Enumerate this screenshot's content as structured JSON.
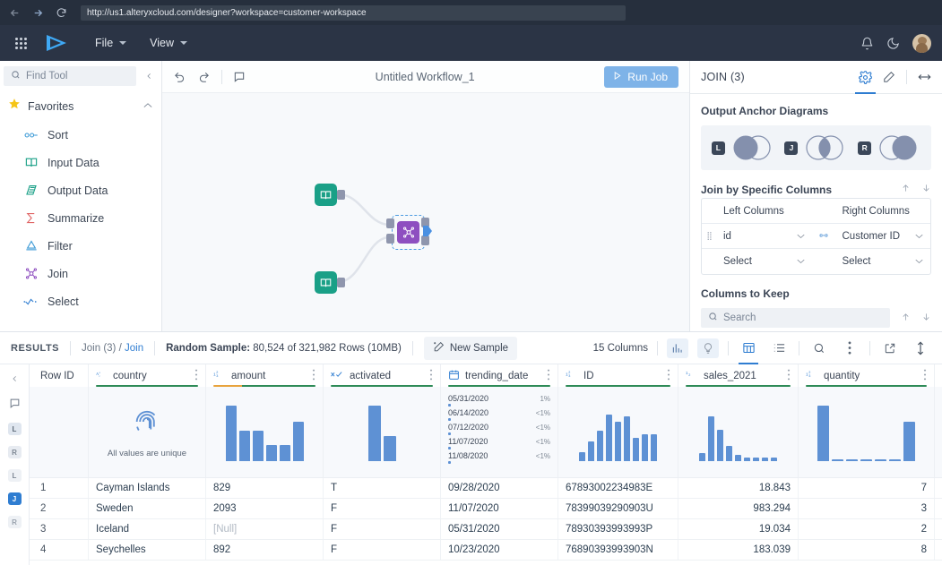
{
  "browser": {
    "url": "http://us1.alteryxcloud.com/designer?workspace=customer-workspace",
    "back_icon": "arrow-left-icon",
    "forward_icon": "arrow-right-icon",
    "reload_icon": "reload-icon"
  },
  "topnav": {
    "apps_icon": "apps-grid-icon",
    "logo_icon": "alteryx-logo-icon",
    "menus": [
      {
        "label": "File"
      },
      {
        "label": "View"
      }
    ],
    "notifications_icon": "bell-icon",
    "theme_icon": "moon-icon",
    "avatar_icon": "user-avatar"
  },
  "sidebar": {
    "search_placeholder": "Find Tool",
    "search_icon": "search-icon",
    "collapse_icon": "chevron-left-icon",
    "group": {
      "label": "Favorites",
      "icon": "star-icon",
      "chevron": "chevron-up-icon"
    },
    "tools": [
      {
        "label": "Sort",
        "icon": "sort-icon"
      },
      {
        "label": "Input Data",
        "icon": "input-data-icon"
      },
      {
        "label": "Output Data",
        "icon": "output-data-icon"
      },
      {
        "label": "Summarize",
        "icon": "summarize-sigma-icon"
      },
      {
        "label": "Filter",
        "icon": "filter-icon"
      },
      {
        "label": "Join",
        "icon": "join-icon"
      },
      {
        "label": "Select",
        "icon": "select-icon"
      }
    ]
  },
  "canvas": {
    "undo_icon": "undo-icon",
    "redo_icon": "redo-icon",
    "comment_icon": "comment-icon",
    "workflow_title": "Untitled Workflow_1",
    "run_button": "Run Job",
    "run_icon": "play-icon",
    "nodes": [
      {
        "name": "input-data-node-1",
        "type": "Input Data"
      },
      {
        "name": "input-data-node-2",
        "type": "Input Data"
      },
      {
        "name": "join-node",
        "type": "Join"
      }
    ]
  },
  "config": {
    "title": "JOIN (3)",
    "tabs": [
      {
        "icon": "gear-icon",
        "active": true
      },
      {
        "icon": "annotation-pen-icon",
        "active": false
      }
    ],
    "expand_icon": "expand-horizontal-icon",
    "anchors_label": "Output Anchor Diagrams",
    "anchors": [
      {
        "badge": "L"
      },
      {
        "badge": "J"
      },
      {
        "badge": "R"
      }
    ],
    "join_label": "Join by Specific Columns",
    "sort_up_icon": "arrow-up-icon",
    "sort_down_icon": "arrow-down-icon",
    "table_headers": {
      "left": "Left Columns",
      "right": "Right Columns"
    },
    "rows": [
      {
        "left": "id",
        "right": "Customer ID",
        "link_icon": "link-icon",
        "grip_icon": "drag-handle-icon"
      },
      {
        "left": "Select",
        "right": "Select"
      }
    ],
    "keep_label": "Columns to Keep",
    "keep_search_placeholder": "Search",
    "keep_search_icon": "search-icon"
  },
  "results": {
    "label": "RESULTS",
    "path_tool": "Join (3)",
    "path_sep": "/",
    "path_anchor": "Join",
    "sample_prefix": "Random Sample:",
    "sample_value": "80,524 of 321,982 Rows (10MB)",
    "new_sample_label": "New Sample",
    "new_sample_icon": "new-sample-icon",
    "columns_count": "15 Columns",
    "toolbar_icons": [
      {
        "name": "data-profile-chart-icon",
        "tint": true,
        "active": false
      },
      {
        "name": "insights-bulb-icon",
        "tint": true,
        "active": false
      },
      {
        "name": "table-view-icon",
        "tint": false,
        "active": true
      },
      {
        "name": "list-view-icon",
        "tint": false,
        "active": false
      },
      {
        "name": "search-icon",
        "tint": false,
        "active": false
      },
      {
        "name": "more-options-icon",
        "tint": false,
        "active": false
      },
      {
        "name": "open-external-icon",
        "tint": false,
        "active": false
      },
      {
        "name": "expand-vertical-icon",
        "tint": false,
        "active": false
      }
    ],
    "rail": {
      "collapse_icon": "chevron-left-icon",
      "comment_icon": "comment-icon",
      "anchors": [
        {
          "label": "L",
          "state": "l1"
        },
        {
          "label": "R",
          "state": "r1"
        },
        {
          "label": "L",
          "state": "l2"
        },
        {
          "label": "J",
          "state": "j"
        },
        {
          "label": "R",
          "state": "r2"
        }
      ]
    }
  },
  "table": {
    "rowid_header": "Row ID",
    "columns": [
      {
        "name": "country",
        "type_icon": "text-type-icon",
        "width": 131,
        "quality": [
          {
            "color": "#2e8b57",
            "pct": 100
          }
        ]
      },
      {
        "name": "amount",
        "type_icon": "number-type-icon",
        "width": 131,
        "quality": [
          {
            "color": "#e8a33d",
            "pct": 28
          },
          {
            "color": "#2e8b57",
            "pct": 72
          }
        ]
      },
      {
        "name": "activated",
        "type_icon": "bool-type-icon",
        "width": 131,
        "quality": [
          {
            "color": "#2e8b57",
            "pct": 100
          }
        ]
      },
      {
        "name": "trending_date",
        "type_icon": "date-type-icon",
        "width": 131,
        "quality": [
          {
            "color": "#2e8b57",
            "pct": 100
          }
        ]
      },
      {
        "name": "ID",
        "type_icon": "number-type-icon",
        "width": 134,
        "quality": [
          {
            "color": "#2e8b57",
            "pct": 100
          }
        ]
      },
      {
        "name": "sales_2021",
        "type_icon": "decimal-type-icon",
        "width": 134,
        "quality": [
          {
            "color": "#2e8b57",
            "pct": 100
          }
        ]
      },
      {
        "name": "quantity",
        "type_icon": "number-type-icon",
        "width": 152,
        "quality": [
          {
            "color": "#2e8b57",
            "pct": 100
          }
        ]
      }
    ],
    "kebab_icon": "column-menu-icon",
    "profiles": [
      {
        "kind": "unique",
        "icon": "fingerprint-icon",
        "text": "All values are unique"
      },
      {
        "kind": "histogram",
        "values": [
          62,
          34,
          34,
          18,
          18,
          44
        ]
      },
      {
        "kind": "histogram",
        "values": [
          62,
          28
        ]
      },
      {
        "kind": "datelist",
        "items": [
          {
            "date": "05/31/2020",
            "pct": "1%"
          },
          {
            "date": "06/14/2020",
            "pct": "<1%"
          },
          {
            "date": "07/12/2020",
            "pct": "<1%"
          },
          {
            "date": "11/07/2020",
            "pct": "<1%"
          },
          {
            "date": "11/08/2020",
            "pct": "<1%"
          }
        ]
      },
      {
        "kind": "histogram",
        "values": [
          10,
          22,
          34,
          52,
          44,
          50,
          26,
          30,
          30
        ]
      },
      {
        "kind": "histogram",
        "values": [
          9,
          50,
          35,
          17,
          7,
          4,
          4,
          4,
          4
        ]
      },
      {
        "kind": "histogram",
        "values": [
          62,
          2,
          2,
          2,
          2,
          2,
          44
        ]
      }
    ],
    "rows": [
      {
        "rowid": "1",
        "country": "Cayman Islands",
        "amount": "829",
        "activated": "T",
        "trending_date": "09/28/2020",
        "ID": "67893002234983E",
        "sales_2021": "18.843",
        "quantity": "7"
      },
      {
        "rowid": "2",
        "country": "Sweden",
        "amount": "2093",
        "activated": "F",
        "trending_date": "11/07/2020",
        "ID": "78399039290903U",
        "sales_2021": "983.294",
        "quantity": "3"
      },
      {
        "rowid": "3",
        "country": "Iceland",
        "amount": "[Null]",
        "amount_null": true,
        "activated": "F",
        "trending_date": "05/31/2020",
        "ID": "78930393993993P",
        "sales_2021": "19.034",
        "quantity": "2"
      },
      {
        "rowid": "4",
        "country": "Seychelles",
        "amount": "892",
        "activated": "F",
        "trending_date": "10/23/2020",
        "ID": "76890393993903N",
        "sales_2021": "183.039",
        "quantity": "8"
      }
    ]
  }
}
